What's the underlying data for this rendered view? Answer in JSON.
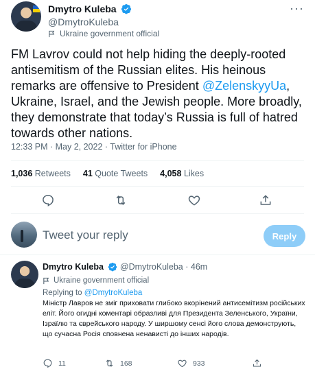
{
  "tweet": {
    "author_name": "Dmytro Kuleba",
    "author_handle": "@DmytroKuleba",
    "label": "Ukraine government official",
    "text_before": "FM Lavrov could not help hiding the deeply-rooted antisemitism of the Russian elites. His heinous remarks are offensive to President ",
    "mention": "@ZelenskyyUa",
    "text_after": ", Ukraine, Israel, and the Jewish people. More broadly, they demonstrate that today’s Russia is full of hatred towards other nations.",
    "meta": "12:33 PM · May 2, 2022 · Twitter for iPhone",
    "retweets_count": "1,036",
    "retweets_label": "Retweets",
    "quotes_count": "41",
    "quotes_label": "Quote Tweets",
    "likes_count": "4,058",
    "likes_label": "Likes",
    "more_icon": "more-horizontal-icon",
    "accent_color": "#1d9bf0"
  },
  "reply_box": {
    "placeholder": "Tweet your reply",
    "button_label": "Reply"
  },
  "reply_tweet": {
    "author_name": "Dmytro Kuleba",
    "author_handle": "@DmytroKuleba",
    "time": "46m",
    "label": "Ukraine government official",
    "replying_prefix": "Replying to",
    "replying_to": "@DmytroKuleba",
    "text": "Міністр Лавров не зміг приховати глибоко вкорінений антисемітизм російських еліт. Його огидні коментарі образливі для Президента Зеленського, України, Ізраїлю та єврейського народу. У ширшому сенсі його слова демонструють, що сучасна Росія сповнена ненависті до інших народів.",
    "replies": "11",
    "retweets": "168",
    "likes": "933"
  }
}
